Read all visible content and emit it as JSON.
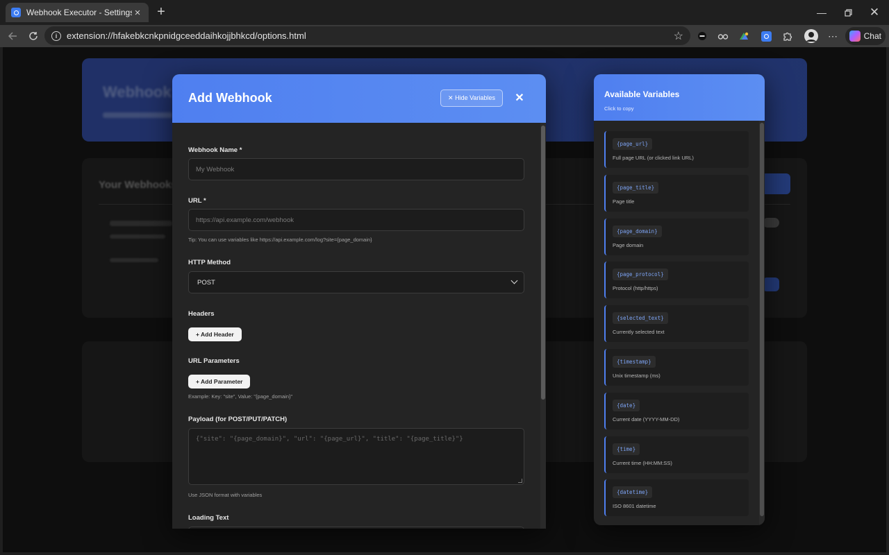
{
  "browser": {
    "tab_title": "Webhook Executor - Settings",
    "url": "extension://hfakebkcnkpnidgceeddaihkojjbhkcd/options.html",
    "chat_label": "Chat"
  },
  "background": {
    "hero_title": "Webhook",
    "card_title": "Your Webhooks"
  },
  "modal": {
    "title": "Add Webhook",
    "hide_variables_label": "✕ Hide Variables",
    "close_label": "✕",
    "name_label": "Webhook Name *",
    "name_placeholder": "My Webhook",
    "url_label": "URL *",
    "url_placeholder": "https://api.example.com/webhook",
    "url_tip": "Tip: You can use variables like https://api.example.com/log?site={page_domain}",
    "method_label": "HTTP Method",
    "method_value": "POST",
    "headers_label": "Headers",
    "add_header_label": "+ Add Header",
    "params_label": "URL Parameters",
    "add_param_label": "+ Add Parameter",
    "params_example": "Example: Key: \"site\", Value: \"{page_domain}\"",
    "payload_label": "Payload (for POST/PUT/PATCH)",
    "payload_placeholder": "{\"site\": \"{page_domain}\", \"url\": \"{page_url}\", \"title\": \"{page_title}\"}",
    "payload_tip": "Use JSON format with variables",
    "loading_label": "Loading Text"
  },
  "variables": {
    "title": "Available Variables",
    "subtitle": "Click to copy",
    "items": [
      {
        "code": "{page_url}",
        "desc": "Full page URL (or clicked link URL)"
      },
      {
        "code": "{page_title}",
        "desc": "Page title"
      },
      {
        "code": "{page_domain}",
        "desc": "Page domain"
      },
      {
        "code": "{page_protocol}",
        "desc": "Protocol (http/https)"
      },
      {
        "code": "{selected_text}",
        "desc": "Currently selected text"
      },
      {
        "code": "{timestamp}",
        "desc": "Unix timestamp (ms)"
      },
      {
        "code": "{date}",
        "desc": "Current date (YYYY-MM-DD)"
      },
      {
        "code": "{time}",
        "desc": "Current time (HH:MM:SS)"
      },
      {
        "code": "{datetime}",
        "desc": "ISO 8601 datetime"
      }
    ]
  },
  "colors": {
    "accent": "#4f7ff0",
    "panel": "#242424",
    "input_bg": "#1c1c1c"
  }
}
